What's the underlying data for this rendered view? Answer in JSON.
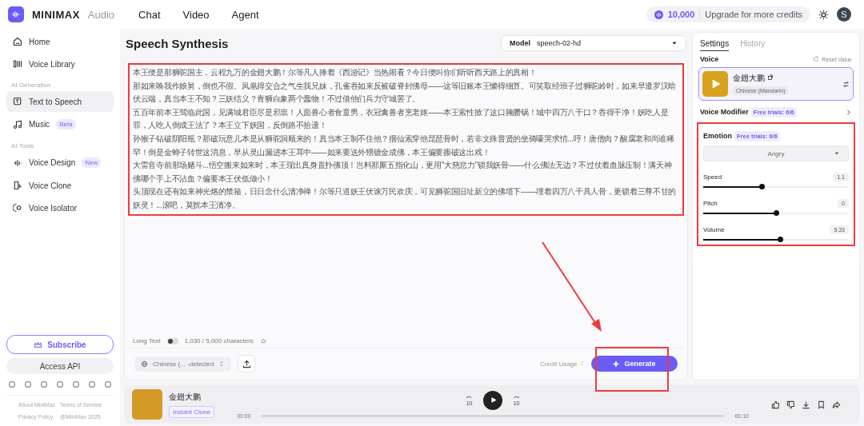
{
  "brand": {
    "name": "MINIMAX",
    "product": "Audio"
  },
  "nav": [
    {
      "label": "Chat"
    },
    {
      "label": "Video"
    },
    {
      "label": "Agent"
    }
  ],
  "credits": {
    "amount": "10,000",
    "upgrade": "Upgrade for more credits"
  },
  "user": {
    "initial": "S"
  },
  "sidebar": {
    "items": [
      {
        "kind": "item",
        "label": "Home",
        "selected": false
      },
      {
        "kind": "item",
        "label": "Voice Library",
        "selected": false
      },
      {
        "kind": "section",
        "label": "AI Generation"
      },
      {
        "kind": "item",
        "label": "Text to Speech",
        "selected": true
      },
      {
        "kind": "item",
        "label": "Music",
        "badge": "Beta",
        "selected": false
      },
      {
        "kind": "section",
        "label": "AI Tools"
      },
      {
        "kind": "item",
        "label": "Voice Design",
        "badge": "New",
        "selected": false
      },
      {
        "kind": "item",
        "label": "Voice Clone",
        "selected": false
      },
      {
        "kind": "item",
        "label": "Voice Isolator",
        "selected": false
      }
    ],
    "subscribe": "Subscribe",
    "access_api": "Access API",
    "footer_links": [
      "About MiniMax",
      "Terms of Service",
      "Privacy Policy",
      "@MiniMax 2025"
    ]
  },
  "page_title": "Speech Synthesis",
  "model": {
    "label": "Model",
    "value": "speech-02-hd"
  },
  "editor": {
    "paragraphs": [
      "本王便是那狮驼国主，云程九万的金翅大鹏！尔等凡人捧着《西游记》当热闹看？今日便叫你们听听西天路上的真相！",
      "那如来唤我作娘舅，倒也不假。凤凰得交合之气生我兄妹，孔雀吞如来反被破脊封佛母——这等旧账本王懒得细算。可笑取经班子过狮驼岭时，如来早遣罗汉暗伏云端，真当本王不知？三妖结义？青狮白象两个蠢物！不过借他们兵力守城罢了。",
      "五百年前本王驾临此国，见满城君臣尽是邪祟！人面兽心者食童男，衣冠禽兽者烹老妪——本王索性掀了这口腌臜锅！城中四万八千口？吞得干净！妖吃人是罪，人吃人倒成王法了？本王立下妖国，反倒路不拾遗！",
      "孙猴子钻破阴阳瓶？那破玩意儿本是从狮驼洞顺来的！真当本王制不住他？掴仙索穿他琵琶骨时，若非文殊普贤的坐骑嚎哭求情...哼！唐僧肉？酸腐老和尚谁稀罕！倒是金蝉子转世这消息，早从灵山漏进本王耳中——如来要送外甥镀金成佛，本王偏要撕破这出戏！",
      "大雷音寺前那场赌斗...悟空搬来如来时，本王现出真身直扑佛顶！岂料那厮五指化山，更用\"大慈悲力\"锁我妖骨——什么佛法无边？不过仗着血脉压制！满天神佛哪个手上不沾血？偏要本王伏低做小！",
      "头顶现在还有如来神光烙的禁箍，日日念什么清净禅！尔等只道妖王伏诛万民欢庆，可见狮驼国旧址新立的佛塔下——埋着四万八千具人骨，更锁着三尊不甘的妖灵！...滚吧，莫扰本王清净。"
    ],
    "long_text": {
      "label": "Long Text",
      "on": false
    },
    "char_count": "1,030 / 5,000 characters",
    "language": "Chinese (... -detected",
    "credit_usage": "Credit Usage",
    "generate": "Generate"
  },
  "settings": {
    "tabs": [
      {
        "label": "Settings",
        "selected": true
      },
      {
        "label": "History",
        "selected": false
      }
    ],
    "voice_label": "Voice",
    "reset": "Reset Value",
    "voice": {
      "name": "金翅大鹏",
      "language": "Chinese (Mandarin)"
    },
    "modifier": {
      "label": "Voice Modifier",
      "trials": "Free trials: 6/6"
    },
    "emotion": {
      "label": "Emotion",
      "trials": "Free trials: 6/6",
      "value": "Angry"
    },
    "sliders": [
      {
        "label": "Speed",
        "reading": "1.1",
        "level": 0.4
      },
      {
        "label": "Pitch",
        "reading": "0",
        "level": 0.5
      },
      {
        "label": "Volume",
        "reading": "5.33",
        "level": 0.53
      }
    ]
  },
  "player": {
    "title": "金翅大鹏",
    "tag": "Instant Clone",
    "skip_back": "10",
    "skip_forward": "10",
    "elapsed": "00:00",
    "duration": "00:10"
  }
}
